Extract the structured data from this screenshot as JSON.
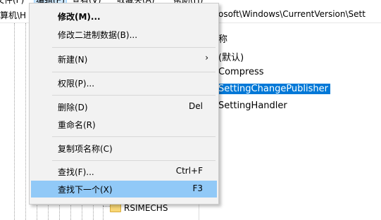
{
  "menubar": {
    "items": [
      "文件(F)",
      "编辑(E)",
      "查看(V)",
      "收藏夹(A)",
      "帮助(H)"
    ]
  },
  "address": {
    "left": "算机\\H",
    "path": "osoft\\Windows\\CurrentVersion\\Sett"
  },
  "tree": {
    "visible_item": "RSIMECHS"
  },
  "values": {
    "header": "称",
    "items": [
      "(默认)",
      "Compress",
      "SettingChangePublisher",
      "SettingHandler"
    ],
    "selected_index": 2
  },
  "context_menu": {
    "items": [
      {
        "label": "修改(M)...",
        "shortcut": "",
        "bold": true
      },
      {
        "label": "修改二进制数据(B)...",
        "shortcut": ""
      },
      {
        "label": "新建(N)",
        "shortcut": "",
        "submenu": true
      },
      {
        "label": "权限(P)...",
        "shortcut": ""
      },
      {
        "label": "删除(D)",
        "shortcut": "Del"
      },
      {
        "label": "重命名(R)",
        "shortcut": ""
      },
      {
        "label": "复制项名称(C)",
        "shortcut": ""
      },
      {
        "label": "查找(F)...",
        "shortcut": "Ctrl+F"
      },
      {
        "label": "查找下一个(X)",
        "shortcut": "F3",
        "highlighted": true
      }
    ],
    "submenu_arrow": "›",
    "colors": {
      "highlight": "#91c9f7",
      "background": "#f2f2f2"
    }
  },
  "colors": {
    "selection": "#0078d7"
  }
}
